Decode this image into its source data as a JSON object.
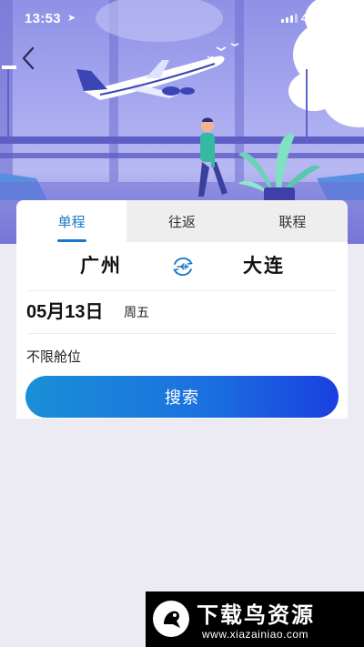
{
  "status_bar": {
    "time": "13:53",
    "network": "4G"
  },
  "tabs": [
    {
      "label": "单程",
      "active": true
    },
    {
      "label": "往返",
      "active": false
    },
    {
      "label": "联程",
      "active": false
    }
  ],
  "route": {
    "from_city": "广州",
    "to_city": "大连"
  },
  "date": {
    "value": "05月13日",
    "weekday": "周五"
  },
  "cabin": {
    "label": "不限舱位"
  },
  "search": {
    "button_label": "搜索"
  },
  "watermark": {
    "title": "下载鸟资源",
    "url": "www.xiazainiao.com"
  },
  "colors": {
    "accent": "#1677c8",
    "button_start": "#1a8fd6",
    "button_end": "#1a3fe0",
    "page_background": "#ecebf3"
  },
  "icons": {
    "back": "chevron-left-icon",
    "swap": "plane-swap-icon",
    "location": "location-arrow-icon",
    "signal": "signal-icon",
    "battery": "battery-icon"
  }
}
